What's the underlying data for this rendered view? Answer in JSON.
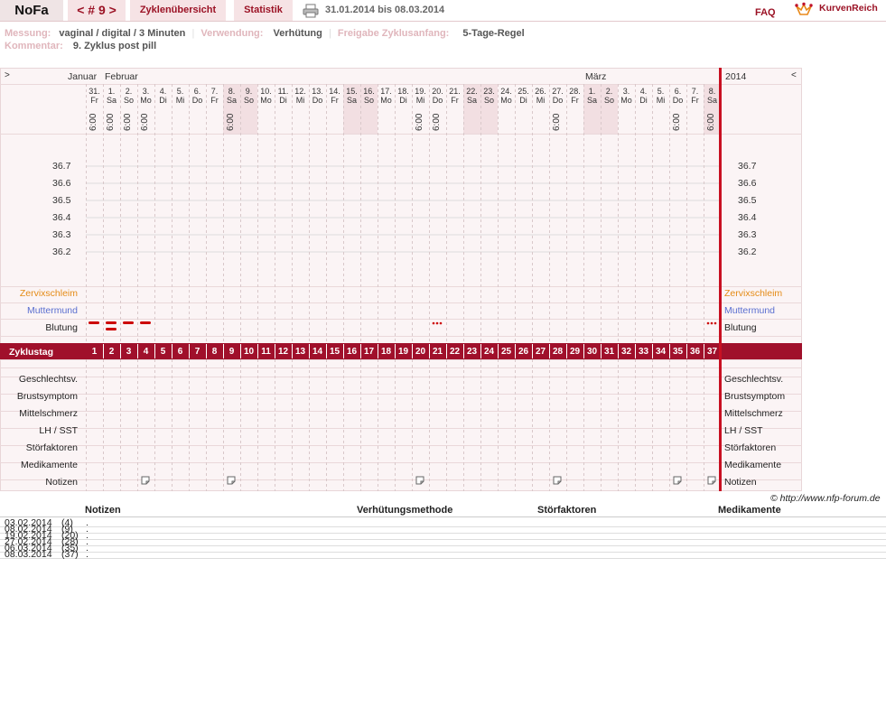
{
  "header": {
    "app_title": "NoFa",
    "cycle_nav": "< # 9 >",
    "tab_cycles": "Zyklenübersicht",
    "tab_stats": "Statistik",
    "date_range": "31.01.2014 bis 08.03.2014",
    "faq": "FAQ",
    "brand": "KurvenReich"
  },
  "meta": {
    "messung_label": "Messung:",
    "messung_value": "vaginal / digital / 3 Minuten",
    "verwendung_label": "Verwendung:",
    "verwendung_value": "Verhütung",
    "freigabe_label": "Freigabe Zyklusanfang:",
    "freigabe_value": "5-Tage-Regel",
    "kommentar_label": "Kommentar:",
    "kommentar_value": "9. Zyklus post pill",
    "separator": "|"
  },
  "chart": {
    "nav_prev": ">",
    "nav_next": "<",
    "months": [
      {
        "name": "Januar",
        "day_index": 0
      },
      {
        "name": "Februar",
        "day_index": 1
      },
      {
        "name": "März",
        "day_index": 29
      }
    ],
    "year": "2014",
    "days": [
      {
        "d": "31.",
        "w": "Fr",
        "t": "6:00",
        "we": false
      },
      {
        "d": "1.",
        "w": "Sa",
        "t": "6:00",
        "we": false
      },
      {
        "d": "2.",
        "w": "So",
        "t": "6:00",
        "we": false
      },
      {
        "d": "3.",
        "w": "Mo",
        "t": "6:00",
        "we": false
      },
      {
        "d": "4.",
        "w": "Di",
        "t": "",
        "we": false
      },
      {
        "d": "5.",
        "w": "Mi",
        "t": "",
        "we": false
      },
      {
        "d": "6.",
        "w": "Do",
        "t": "",
        "we": false
      },
      {
        "d": "7.",
        "w": "Fr",
        "t": "",
        "we": false
      },
      {
        "d": "8.",
        "w": "Sa",
        "t": "6:00",
        "we": true
      },
      {
        "d": "9.",
        "w": "So",
        "t": "",
        "we": true
      },
      {
        "d": "10.",
        "w": "Mo",
        "t": "",
        "we": false
      },
      {
        "d": "11.",
        "w": "Di",
        "t": "",
        "we": false
      },
      {
        "d": "12.",
        "w": "Mi",
        "t": "",
        "we": false
      },
      {
        "d": "13.",
        "w": "Do",
        "t": "",
        "we": false
      },
      {
        "d": "14.",
        "w": "Fr",
        "t": "",
        "we": false
      },
      {
        "d": "15.",
        "w": "Sa",
        "t": "",
        "we": true
      },
      {
        "d": "16.",
        "w": "So",
        "t": "",
        "we": true
      },
      {
        "d": "17.",
        "w": "Mo",
        "t": "",
        "we": false
      },
      {
        "d": "18.",
        "w": "Di",
        "t": "",
        "we": false
      },
      {
        "d": "19.",
        "w": "Mi",
        "t": "6:00",
        "we": false
      },
      {
        "d": "20.",
        "w": "Do",
        "t": "6:00",
        "we": false
      },
      {
        "d": "21.",
        "w": "Fr",
        "t": "",
        "we": false
      },
      {
        "d": "22.",
        "w": "Sa",
        "t": "",
        "we": true
      },
      {
        "d": "23.",
        "w": "So",
        "t": "",
        "we": true
      },
      {
        "d": "24.",
        "w": "Mo",
        "t": "",
        "we": false
      },
      {
        "d": "25.",
        "w": "Di",
        "t": "",
        "we": false
      },
      {
        "d": "26.",
        "w": "Mi",
        "t": "",
        "we": false
      },
      {
        "d": "27.",
        "w": "Do",
        "t": "6:00",
        "we": false
      },
      {
        "d": "28.",
        "w": "Fr",
        "t": "",
        "we": false
      },
      {
        "d": "1.",
        "w": "Sa",
        "t": "",
        "we": true
      },
      {
        "d": "2.",
        "w": "So",
        "t": "",
        "we": true
      },
      {
        "d": "3.",
        "w": "Mo",
        "t": "",
        "we": false
      },
      {
        "d": "4.",
        "w": "Di",
        "t": "",
        "we": false
      },
      {
        "d": "5.",
        "w": "Mi",
        "t": "",
        "we": false
      },
      {
        "d": "6.",
        "w": "Do",
        "t": "6:00",
        "we": false
      },
      {
        "d": "7.",
        "w": "Fr",
        "t": "",
        "we": false
      },
      {
        "d": "8.",
        "w": "Sa",
        "t": "6:00",
        "we": true
      }
    ],
    "temps": [
      "36.7",
      "36.6",
      "36.5",
      "36.4",
      "36.3",
      "36.2"
    ],
    "rows": {
      "zervix": "Zervixschleim",
      "mutter": "Muttermund",
      "blutung": "Blutung",
      "zyklustag": "Zyklustag",
      "gv": "Geschlechtsv.",
      "brust": "Brustsymptom",
      "mittel": "Mittelschmerz",
      "lh": "LH / SST",
      "stoer": "Störfaktoren",
      "medi": "Medikamente",
      "notizen": "Notizen"
    },
    "bleeding": [
      {
        "day": 1,
        "type": "dash1"
      },
      {
        "day": 2,
        "type": "dash2"
      },
      {
        "day": 3,
        "type": "dash1"
      },
      {
        "day": 4,
        "type": "dash1"
      },
      {
        "day": 21,
        "type": "dots"
      },
      {
        "day": 37,
        "type": "dots"
      }
    ],
    "note_days": [
      4,
      9,
      20,
      28,
      35,
      37
    ],
    "highlight_days": [
      9,
      10,
      16,
      17,
      23,
      24,
      30,
      31,
      37
    ],
    "current_day": 37
  },
  "credit": "© http://www.nfp-forum.de",
  "notes": {
    "headers": {
      "notizen": "Notizen",
      "verhuetung": "Verhütungsmethode",
      "stoer": "Störfaktoren",
      "medi": "Medikamente"
    },
    "entries": [
      {
        "date": "03.02.2014",
        "day": "(4)",
        "text": "."
      },
      {
        "date": "08.02.2014",
        "day": "(9)",
        "text": "."
      },
      {
        "date": "19.02.2014",
        "day": "(20)",
        "text": "."
      },
      {
        "date": "27.02.2014",
        "day": "(28)",
        "text": "."
      },
      {
        "date": "06.03.2014",
        "day": "(35)",
        "text": "."
      },
      {
        "date": "08.03.2014",
        "day": "(37)",
        "text": "."
      }
    ]
  },
  "colors": {
    "brand": "#9b1225",
    "band": "#a0102b",
    "grid_bg": "#fbf4f5",
    "zervix": "#e48b16",
    "mutter": "#5a6fd0"
  }
}
